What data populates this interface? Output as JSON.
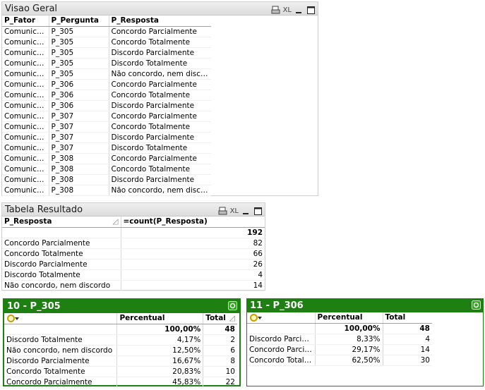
{
  "visao_geral": {
    "title": "Visao Geral",
    "headers": [
      "P_Fator",
      "P_Pergunta",
      "P_Resposta"
    ],
    "rows": [
      [
        "Comunicacao",
        "P_305",
        "Concordo Parcialmente"
      ],
      [
        "Comunicacao",
        "P_305",
        "Concordo Totalmente"
      ],
      [
        "Comunicacao",
        "P_305",
        "Discordo Parcialmente"
      ],
      [
        "Comunicacao",
        "P_305",
        "Discordo Totalmente"
      ],
      [
        "Comunicacao",
        "P_305",
        "Não concordo,  nem discordo"
      ],
      [
        "Comunicacao",
        "P_306",
        "Concordo Parcialmente"
      ],
      [
        "Comunicacao",
        "P_306",
        "Concordo Totalmente"
      ],
      [
        "Comunicacao",
        "P_306",
        "Discordo Parcialmente"
      ],
      [
        "Comunicacao",
        "P_307",
        "Concordo Parcialmente"
      ],
      [
        "Comunicacao",
        "P_307",
        "Concordo Totalmente"
      ],
      [
        "Comunicacao",
        "P_307",
        "Discordo Parcialmente"
      ],
      [
        "Comunicacao",
        "P_307",
        "Discordo Totalmente"
      ],
      [
        "Comunicacao",
        "P_308",
        "Concordo Parcialmente"
      ],
      [
        "Comunicacao",
        "P_308",
        "Concordo Totalmente"
      ],
      [
        "Comunicacao",
        "P_308",
        "Discordo Parcialmente"
      ],
      [
        "Comunicacao",
        "P_308",
        "Não concordo,  nem discordo"
      ]
    ]
  },
  "tabela_resultado": {
    "title": "Tabela Resultado",
    "headers": [
      "P_Resposta",
      "=count(P_Resposta)"
    ],
    "total": "192",
    "rows": [
      [
        "Concordo Parcialmente",
        "82"
      ],
      [
        "Concordo Totalmente",
        "66"
      ],
      [
        "Discordo Parcialmente",
        "26"
      ],
      [
        "Discordo Totalmente",
        "4"
      ],
      [
        "Não concordo,  nem discordo",
        "14"
      ]
    ]
  },
  "p305": {
    "title": "10 -  P_305",
    "headers": [
      "",
      "Percentual",
      "Total"
    ],
    "totals": [
      "100,00%",
      "48"
    ],
    "rows": [
      [
        "Discordo Totalmente",
        "4,17%",
        "2"
      ],
      [
        "Não concordo,  nem discordo",
        "12,50%",
        "6"
      ],
      [
        "Discordo Parcialmente",
        "16,67%",
        "8"
      ],
      [
        "Concordo Totalmente",
        "20,83%",
        "10"
      ],
      [
        "Concordo Parcialmente",
        "45,83%",
        "22"
      ]
    ]
  },
  "p306": {
    "title": "11 -  P_306",
    "headers": [
      "",
      "Percentual",
      "Total"
    ],
    "totals": [
      "100,00%",
      "48"
    ],
    "rows": [
      [
        "Discordo Parcialmente",
        "8,33%",
        "4"
      ],
      [
        "Concordo Parcialmente",
        "29,17%",
        "14"
      ],
      [
        "Concordo Totalmente",
        "62,50%",
        "30"
      ]
    ]
  },
  "caption_icons": {
    "print_icon": "print-icon",
    "excel_label": "XL",
    "minimize_icon": "minimize-icon",
    "restore_icon": "restore-icon"
  },
  "colors": {
    "green_caption": "#1e7f13",
    "grey_caption": "#e4e4e4"
  }
}
